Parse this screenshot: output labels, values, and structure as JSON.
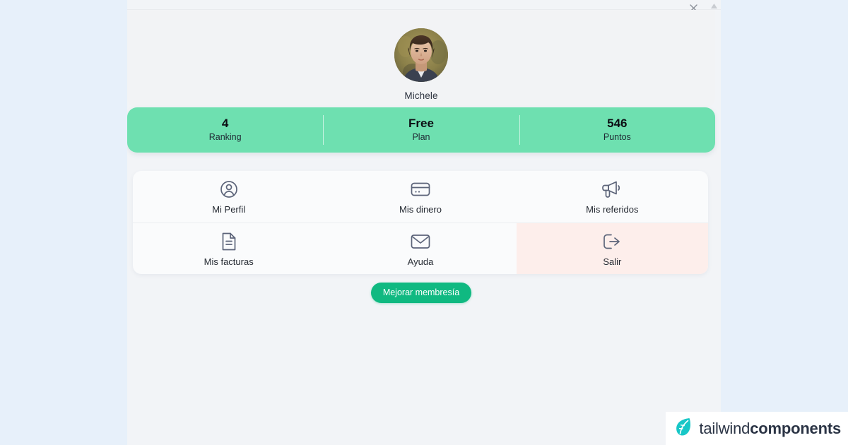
{
  "page": {
    "background_color": "#e7f0fa",
    "modal_background": "#f2f4f7"
  },
  "modal": {
    "close_icon": "close-icon",
    "scroll_arrow_icon": "scroll-up-arrow-icon"
  },
  "profile": {
    "name": "Michele",
    "avatar_alt": "user-avatar-photo"
  },
  "stats": {
    "accent_color": "#6ee0b0",
    "items": [
      {
        "value": "4",
        "label": "Ranking"
      },
      {
        "value": "Free",
        "label": "Plan"
      },
      {
        "value": "546",
        "label": "Puntos"
      }
    ]
  },
  "menu": {
    "rows": [
      [
        {
          "label": "Mi Perfil",
          "icon": "user-circle-icon",
          "danger": false
        },
        {
          "label": "Mis dinero",
          "icon": "credit-card-icon",
          "danger": false
        },
        {
          "label": "Mis referidos",
          "icon": "megaphone-icon",
          "danger": false
        }
      ],
      [
        {
          "label": "Mis facturas",
          "icon": "document-icon",
          "danger": false
        },
        {
          "label": "Ayuda",
          "icon": "envelope-icon",
          "danger": false
        },
        {
          "label": "Salir",
          "icon": "logout-icon",
          "danger": true
        }
      ]
    ],
    "danger_background": "#fdeeeb"
  },
  "cta": {
    "label": "Mejorar membresía",
    "color": "#10b981"
  },
  "watermark": {
    "text_light": "tailwind",
    "text_bold": "components",
    "logo_color": "#18c7c7",
    "icon": "leaf-logo-icon"
  }
}
